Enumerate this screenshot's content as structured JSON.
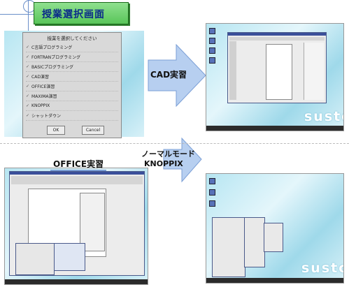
{
  "title": "授業選択画面",
  "login_dialog": {
    "heading": "授業を選択してください",
    "items": [
      "C言語プログラミング",
      "FORTRANプログラミング",
      "BASICプログラミング",
      "CAD演習",
      "OFFICE演習",
      "MAXIMA演習",
      "KNOPPIX",
      "シャットダウン"
    ],
    "ok_label": "OK",
    "cancel_label": "Cancel"
  },
  "arrows": {
    "cad": "CAD実習",
    "office": "OFFICE実習",
    "knoppix_line1": "ノーマルモード",
    "knoppix_line2": "KNOPPIX"
  },
  "desktop_text": "sustc",
  "colors": {
    "title_bg": "#6fd06f",
    "title_text": "#0a2a8a",
    "arrow": "#a9c6ec",
    "window_title": "#3a4f9a"
  }
}
